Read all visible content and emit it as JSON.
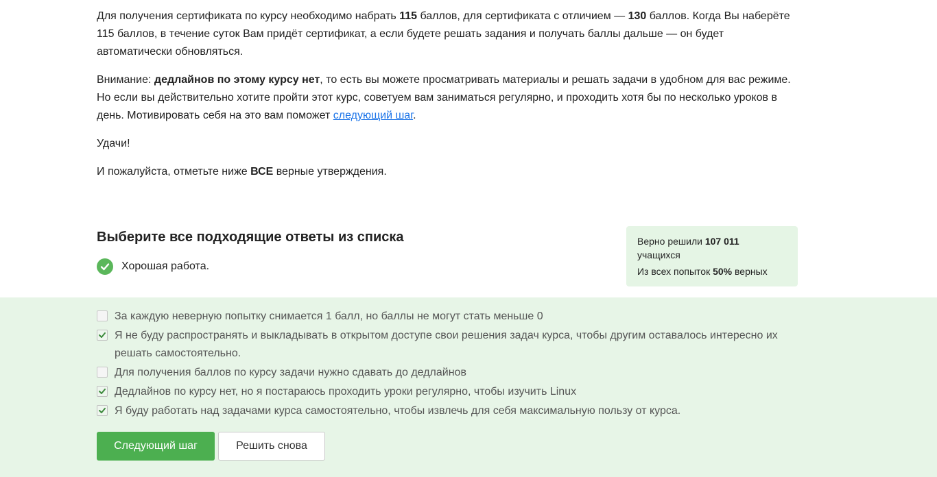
{
  "intro": {
    "p1_a": "Для получения сертификата по курсу необходимо набрать ",
    "p1_b": "115",
    "p1_c": " баллов, для сертификата с отличием — ",
    "p1_d": "130",
    "p1_e": " баллов. Когда Вы наберёте 115 баллов, в течение суток Вам придёт сертификат, а если будете решать задания и получать баллы дальше — он будет автоматически обновляться.",
    "p2_a": "Внимание: ",
    "p2_b": "дедлайнов по этому курсу нет",
    "p2_c": ", то есть вы можете просматривать материалы и решать задачи в удобном для вас режиме. Но если вы действительно хотите пройти этот курс, советуем вам заниматься регулярно, и проходить хотя бы по несколько уроков в день. Мотивировать себя на это вам поможет ",
    "p2_link": "следующий шаг",
    "p2_d": ".",
    "p3": "Удачи!",
    "p4_a": "И пожалуйста, отметьте ниже ",
    "p4_b": "ВСЕ",
    "p4_c": " верные утверждения."
  },
  "quiz": {
    "title": "Выберите все подходящие ответы из списка",
    "feedback": "Хорошая работа."
  },
  "stats": {
    "solved_label": "Верно решили ",
    "solved_count": "107 011",
    "solved_suffix": "учащихся",
    "attempts_label": "Из всех попыток ",
    "attempts_percent": "50%",
    "attempts_suffix": " верных"
  },
  "options": [
    {
      "text": "За каждую неверную попытку снимается 1 балл, но баллы не могут стать меньше 0",
      "checked": false
    },
    {
      "text": "Я не буду распространять и выкладывать в открытом доступе свои решения задач курса, чтобы другим оставалось интересно их решать самостоятельно.",
      "checked": true
    },
    {
      "text": "Для получения баллов по курсу задачи нужно сдавать до дедлайнов",
      "checked": false
    },
    {
      "text": "Дедлайнов по курсу нет, но я постараюсь проходить уроки регулярно, чтобы изучить Linux",
      "checked": true
    },
    {
      "text": "Я буду работать над задачами курса самостоятельно, чтобы извлечь для себя максимальную пользу от курса.",
      "checked": true
    }
  ],
  "buttons": {
    "next": "Следующий шаг",
    "retry": "Решить снова"
  },
  "colors": {
    "accent": "#4caf50",
    "panel_bg": "#e7f5e7",
    "link": "#1a73e8"
  }
}
